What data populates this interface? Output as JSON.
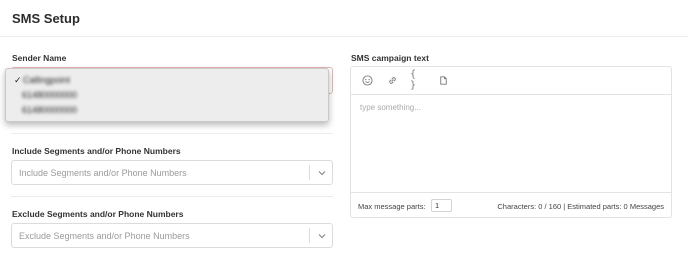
{
  "header": {
    "title": "SMS Setup"
  },
  "sender": {
    "label": "Sender Name",
    "dropdown": {
      "options": [
        {
          "text": "Callingpoint",
          "selected": true,
          "check": "✓"
        },
        {
          "text": "61480000000",
          "selected": false
        },
        {
          "text": "61480000000",
          "selected": false
        }
      ]
    }
  },
  "include": {
    "label": "Include Segments and/or Phone Numbers",
    "placeholder": "Include Segments and/or Phone Numbers"
  },
  "exclude": {
    "label": "Exclude Segments and/or Phone Numbers",
    "placeholder": "Exclude Segments and/or Phone Numbers"
  },
  "sms": {
    "label": "SMS campaign text",
    "toolbar": [
      "emoji-icon",
      "link-icon",
      "braces-icon",
      "attachment-icon"
    ],
    "textarea_placeholder": "type something...",
    "max_parts_label": "Max message parts:",
    "max_parts_value": "1",
    "characters_info": "Characters: 0 / 160 | Estimated parts: 0 Messages"
  },
  "colors": {
    "text": "#2d2d2d",
    "border": "#dcdcdc",
    "dropdown_bg": "#ededed"
  }
}
